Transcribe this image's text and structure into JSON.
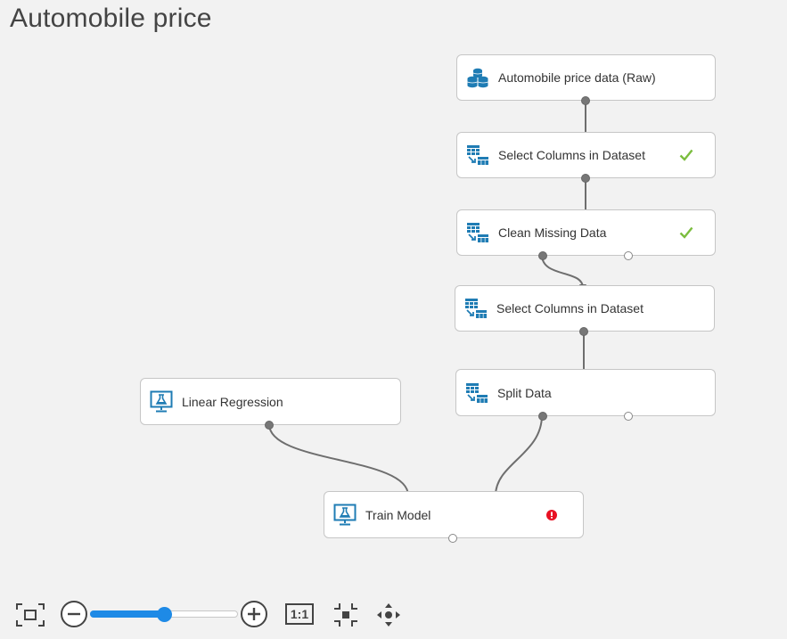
{
  "experiment": {
    "title": "Automobile price"
  },
  "modules": {
    "raw_data": {
      "label": "Automobile price data (Raw)",
      "icon": "dataset-icon"
    },
    "select_columns_1": {
      "label": "Select Columns in Dataset",
      "icon": "data-transform-icon",
      "status": "completed"
    },
    "clean_missing": {
      "label": "Clean Missing Data",
      "icon": "data-transform-icon",
      "status": "completed"
    },
    "select_columns_2": {
      "label": "Select Columns in Dataset",
      "icon": "data-transform-icon"
    },
    "split_data": {
      "label": "Split Data",
      "icon": "data-transform-icon"
    },
    "linear_regression": {
      "label": "Linear Regression",
      "icon": "ml-model-icon"
    },
    "train_model": {
      "label": "Train Model",
      "icon": "ml-model-icon",
      "status": "error"
    }
  },
  "toolbar": {
    "fit_to_screen": "fit-to-screen-icon",
    "zoom_out": "zoom-out-icon",
    "zoom_in": "zoom-in-icon",
    "actual_size_label": "1:1",
    "zoom_level_fraction": 0.5,
    "center": "center-icon",
    "pan": "pan-icon"
  },
  "colors": {
    "accent": "#1e8ae6",
    "icon": "#1f7cb4",
    "success": "#7bbd3e",
    "error": "#e81123",
    "connector": "#6e6e6e"
  }
}
